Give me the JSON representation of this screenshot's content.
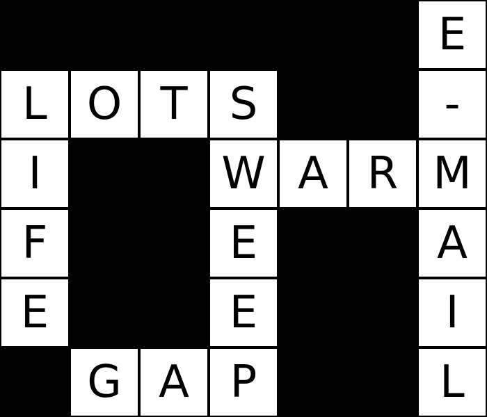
{
  "puzzle": {
    "type": "crossword",
    "rows": 6,
    "cols": 7,
    "colors": {
      "white": "#FFFFFF",
      "black": "#000000"
    },
    "grid": [
      [
        "#",
        "#",
        "#",
        "#",
        "#",
        "#",
        "E"
      ],
      [
        "L",
        "O",
        "T",
        "S",
        "#",
        "#",
        "-"
      ],
      [
        "I",
        "#",
        "#",
        "W",
        "A",
        "R",
        "M"
      ],
      [
        "F",
        "#",
        "#",
        "E",
        "#",
        "#",
        "A"
      ],
      [
        "E",
        "#",
        "#",
        "E",
        "#",
        "#",
        "I"
      ],
      [
        "#",
        "G",
        "A",
        "P",
        "#",
        "#",
        "L"
      ]
    ]
  }
}
